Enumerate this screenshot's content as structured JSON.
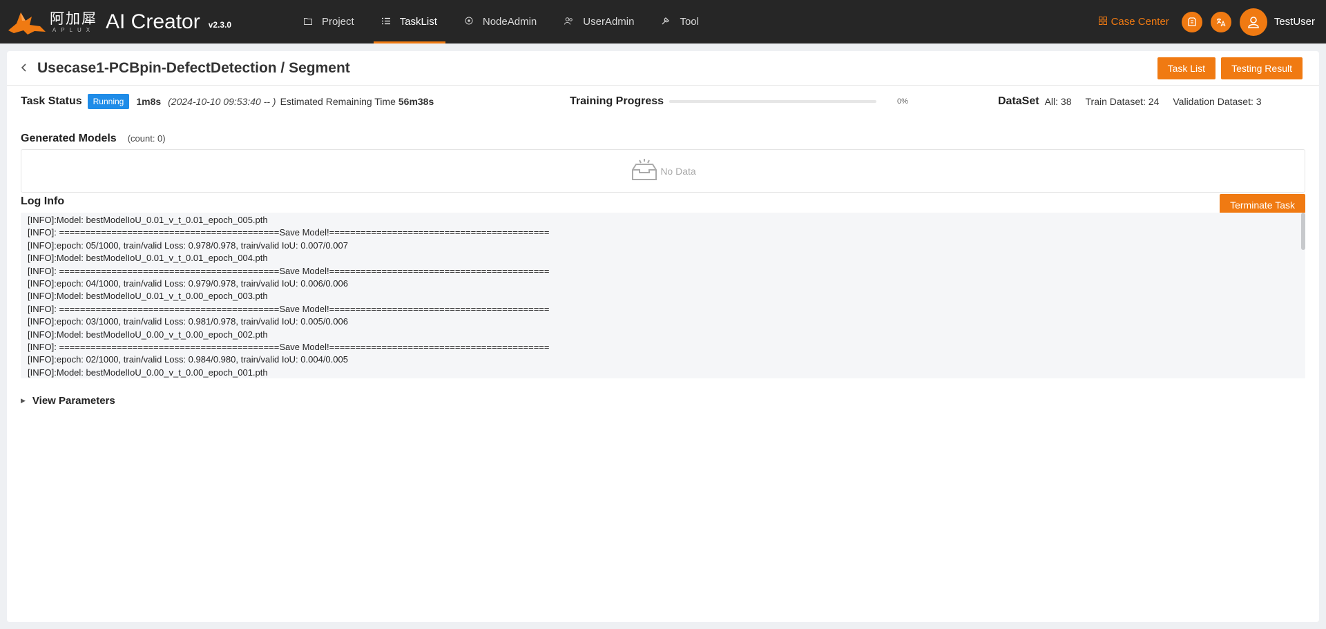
{
  "brand": {
    "cn_name": "阿加犀",
    "en_name": "APLUX",
    "title": "AI Creator",
    "version": "v2.3.0",
    "accent": "#f07a12"
  },
  "nav": [
    {
      "label": "Project",
      "icon": "folder-icon",
      "active": false
    },
    {
      "label": "TaskList",
      "icon": "list-icon",
      "active": true
    },
    {
      "label": "NodeAdmin",
      "icon": "node-icon",
      "active": false
    },
    {
      "label": "UserAdmin",
      "icon": "users-icon",
      "active": false
    },
    {
      "label": "Tool",
      "icon": "tool-icon",
      "active": false
    }
  ],
  "topright": {
    "case_center": "Case Center",
    "username": "TestUser"
  },
  "header": {
    "title": "Usecase1-PCBpin-DefectDetection / Segment",
    "task_list_btn": "Task List",
    "testing_result_btn": "Testing Result"
  },
  "status": {
    "label": "Task Status",
    "badge": "Running",
    "badge_color": "#1f8ce8",
    "elapsed": "1m8s",
    "started": "(2024-10-10 09:53:40 -- )",
    "remaining_label": "Estimated Remaining Time",
    "remaining": "56m38s"
  },
  "progress": {
    "label": "Training Progress",
    "value_percent": 0,
    "text": "0%"
  },
  "dataset": {
    "label": "DataSet",
    "all": "All: 38",
    "train": "Train Dataset: 24",
    "validation": "Validation Dataset: 3"
  },
  "models": {
    "title": "Generated Models",
    "count": "(count:  0)",
    "empty": "No Data"
  },
  "log": {
    "title": "Log Info",
    "terminate_btn": "Terminate Task",
    "lines": [
      "[INFO]:Model: bestModelIoU_0.01_v_t_0.01_epoch_005.pth",
      "[INFO]: ==========================================Save Model!==========================================",
      "[INFO]:epoch: 05/1000, train/valid Loss: 0.978/0.978, train/valid IoU: 0.007/0.007",
      "[INFO]:Model: bestModelIoU_0.01_v_t_0.01_epoch_004.pth",
      "[INFO]: ==========================================Save Model!==========================================",
      "[INFO]:epoch: 04/1000, train/valid Loss: 0.979/0.978, train/valid IoU: 0.006/0.006",
      "[INFO]:Model: bestModelIoU_0.01_v_t_0.00_epoch_003.pth",
      "[INFO]: ==========================================Save Model!==========================================",
      "[INFO]:epoch: 03/1000, train/valid Loss: 0.981/0.978, train/valid IoU: 0.005/0.006",
      "[INFO]:Model: bestModelIoU_0.00_v_t_0.00_epoch_002.pth",
      "[INFO]: ==========================================Save Model!==========================================",
      "[INFO]:epoch: 02/1000, train/valid Loss: 0.984/0.980, train/valid IoU: 0.004/0.005",
      "[INFO]:Model: bestModelIoU_0.00_v_t_0.00_epoch_001.pth"
    ]
  },
  "params": {
    "label": "View Parameters"
  }
}
